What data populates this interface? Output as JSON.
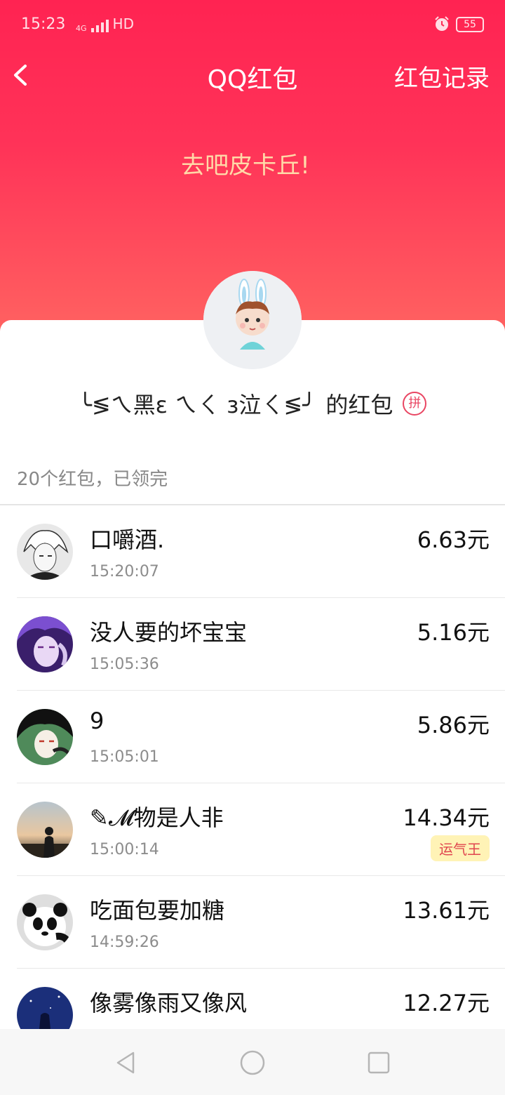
{
  "status": {
    "time": "15:23",
    "network": "4G",
    "hd": "HD",
    "battery": "55"
  },
  "nav": {
    "title": "QQ红包",
    "records": "红包记录"
  },
  "greeting": "去吧皮卡丘!",
  "owner": {
    "name": "╰≶ㄟ黑ε ㄟㄑ з泣ㄑ≶╯",
    "suffix": "的红包",
    "badge": "拼"
  },
  "summary": "20个红包，已领完",
  "recipients": [
    {
      "name": "口嚼酒.",
      "time": "15:20:07",
      "amount": "6.63元",
      "lucky": ""
    },
    {
      "name": "没人要的坏宝宝",
      "time": "15:05:36",
      "amount": "5.16元",
      "lucky": ""
    },
    {
      "name": "9",
      "time": "15:05:01",
      "amount": "5.86元",
      "lucky": ""
    },
    {
      "name": "✎𝓜物是人非",
      "time": "15:00:14",
      "amount": "14.34元",
      "lucky": "运气王"
    },
    {
      "name": "吃面包要加糖",
      "time": "14:59:26",
      "amount": "13.61元",
      "lucky": ""
    },
    {
      "name": "像雾像雨又像风",
      "time": "",
      "amount": "12.27元",
      "lucky": ""
    }
  ],
  "colors": {
    "header_top": "#ff2352",
    "header_bottom": "#ff6a62",
    "greeting": "#ffd9a8",
    "lucky_bg": "#fff3b6",
    "lucky_text": "#e0454f"
  }
}
